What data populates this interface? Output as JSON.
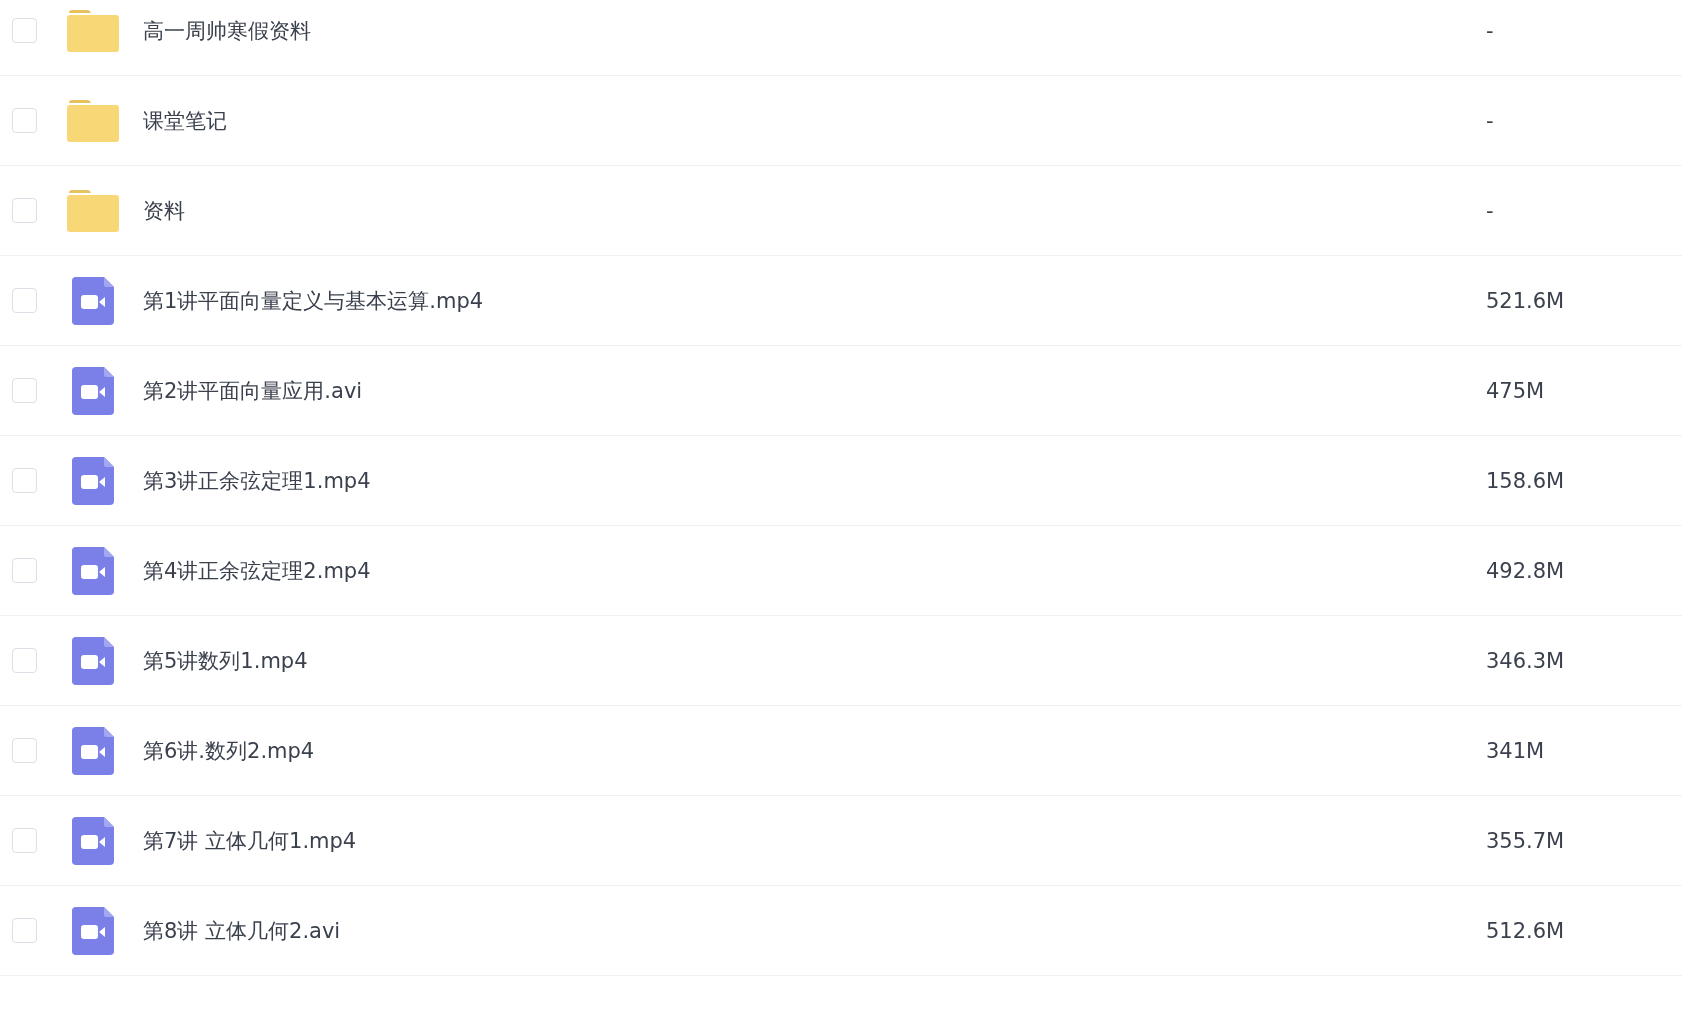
{
  "files": [
    {
      "kind": "folder",
      "name": "高一周帅寒假资料",
      "size": "-",
      "checked": false
    },
    {
      "kind": "folder",
      "name": "课堂笔记",
      "size": "-",
      "checked": false
    },
    {
      "kind": "folder",
      "name": "资料",
      "size": "-",
      "checked": false
    },
    {
      "kind": "video",
      "name": "第1讲平面向量定义与基本运算.mp4",
      "size": "521.6M",
      "checked": false
    },
    {
      "kind": "video",
      "name": "第2讲平面向量应用.avi",
      "size": "475M",
      "checked": false
    },
    {
      "kind": "video",
      "name": "第3讲正余弦定理1.mp4",
      "size": "158.6M",
      "checked": false
    },
    {
      "kind": "video",
      "name": "第4讲正余弦定理2.mp4",
      "size": "492.8M",
      "checked": false
    },
    {
      "kind": "video",
      "name": "第5讲数列1.mp4",
      "size": "346.3M",
      "checked": false
    },
    {
      "kind": "video",
      "name": "第6讲.数列2.mp4",
      "size": "341M",
      "checked": false
    },
    {
      "kind": "video",
      "name": "第7讲 立体几何1.mp4",
      "size": "355.7M",
      "checked": false
    },
    {
      "kind": "video",
      "name": "第8讲 立体几何2.avi",
      "size": "512.6M",
      "checked": false
    }
  ]
}
